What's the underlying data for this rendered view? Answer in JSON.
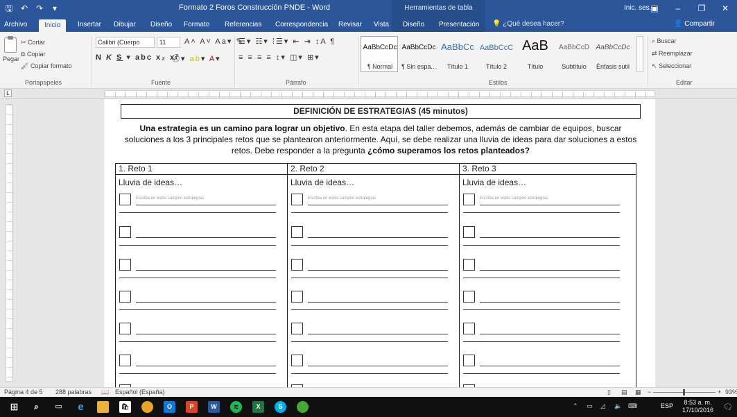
{
  "window": {
    "title": "Formato 2 Foros Construcción PNDE - Word",
    "context_title": "Herramientas de tabla",
    "sign_in": "Inic. ses."
  },
  "tabs": [
    "Archivo",
    "Inicio",
    "Insertar",
    "Dibujar",
    "Diseño",
    "Formato",
    "Referencias",
    "Correspondencia",
    "Revisar",
    "Vista",
    "Diseño",
    "Presentación"
  ],
  "tell_me": "¿Qué desea hacer?",
  "share": "Compartir",
  "ribbon": {
    "clipboard": {
      "paste": "Pegar",
      "cut": "Cortar",
      "copy": "Copiar",
      "format_painter": "Copiar formato",
      "label": "Portapapeles"
    },
    "font": {
      "name": "Calibri (Cuerpo",
      "size": "11",
      "label": "Fuente"
    },
    "paragraph": {
      "label": "Párrafo"
    },
    "styles": {
      "label": "Estilos",
      "items": [
        {
          "sample": "AaBbCcDc",
          "name": "¶ Normal"
        },
        {
          "sample": "AaBbCcDc",
          "name": "¶ Sin espa..."
        },
        {
          "sample": "AaBbCc",
          "name": "Título 1"
        },
        {
          "sample": "AaBbCcC",
          "name": "Título 2"
        },
        {
          "sample": "AaB",
          "name": "Título"
        },
        {
          "sample": "AaBbCcD",
          "name": "Subtítulo"
        },
        {
          "sample": "AaBbCcDc",
          "name": "Énfasis sutil"
        }
      ]
    },
    "editing": {
      "find": "Buscar",
      "replace": "Reemplazar",
      "select": "Seleccionar",
      "label": "Editar"
    }
  },
  "document": {
    "heading": "DEFINICIÓN DE ESTRATEGIAS (45 minutos)",
    "intro_bold": "Una estrategia es un camino para lograr un objetivo",
    "intro_body": ". En esta etapa del taller debemos, además de cambiar de equipos, buscar soluciones a los 3 principales retos que se plantearon anteriormente. Aquí, se debe realizar una lluvia de ideas para dar soluciones a estos retos. Debe responder a la pregunta ",
    "intro_question": "¿cómo superamos los retos planteados?",
    "columns": [
      {
        "header": "1. Reto 1",
        "label": "Lluvia de ideas…"
      },
      {
        "header": "2. Reto 2",
        "label": "Lluvia de ideas…"
      },
      {
        "header": "3. Reto 3",
        "label": "Lluvia de ideas…"
      }
    ],
    "placeholder": "Escriba en estos campos estrategias"
  },
  "status": {
    "page": "Página 4 de 5",
    "words": "288 palabras",
    "language": "Español (España)",
    "zoom": "93%"
  },
  "taskbar": {
    "lang": "ESP",
    "time": "8:53 a. m.",
    "date": "17/10/2016"
  }
}
